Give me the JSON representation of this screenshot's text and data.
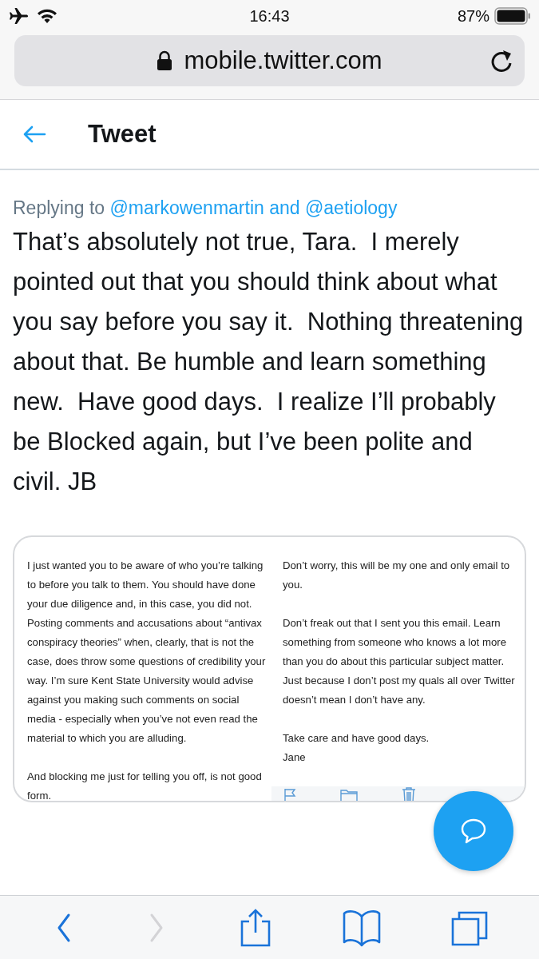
{
  "status_bar": {
    "time": "16:43",
    "battery": "87%",
    "airplane_mode": true,
    "wifi": true
  },
  "browser": {
    "url": "mobile.twitter.com",
    "secure": true
  },
  "header": {
    "title": "Tweet"
  },
  "tweet": {
    "replying_label": "Replying to",
    "mentions": [
      "@markowenmartin",
      "@aetiology"
    ],
    "mention_joiner": "and",
    "text": "That’s absolutely not true, Tara.  I merely pointed out that you should think about what you say before you say it.  Nothing threatening about that. Be humble and learn something new.  Have good days.  I realize I’ll probably be Blocked again, but I’ve been polite and civil. JB"
  },
  "email": {
    "left_paragraphs": [
      "I just wanted you to be aware of who you’re talking to before you talk to them.  You should have done your due diligence and, in this case, you did not.  Posting comments and accusations about “antivax conspiracy theories” when, clearly, that is not the case, does throw some questions of credibility your way.  I’m sure Kent State University would advise against you making such comments on social media - especially when you’ve not even read the material to which you are alluding.",
      "And blocking me just for telling you off, is not good form."
    ],
    "right_paragraphs": [
      "Don’t worry, this will be my one and only email to you.",
      "Don’t freak out that I sent you this email. Learn something from someone who knows a lot more than you do about this particular subject matter.  Just because I don’t post my quals all over Twitter doesn’t mean I don’t have any.",
      "Take care and have good days.\nJane"
    ],
    "toolbar": [
      {
        "kind": "flag"
      },
      {
        "kind": "folder"
      },
      {
        "kind": "trash"
      }
    ]
  },
  "bottom_bar": [
    {
      "kind": "back",
      "disabled": false
    },
    {
      "kind": "forward",
      "disabled": true
    },
    {
      "kind": "share",
      "disabled": false
    },
    {
      "kind": "bookmarks",
      "disabled": false
    },
    {
      "kind": "tabs",
      "disabled": false
    }
  ]
}
